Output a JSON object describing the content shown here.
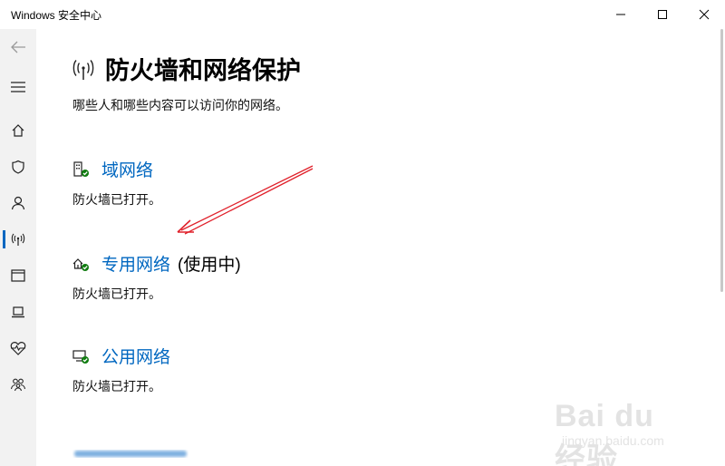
{
  "window": {
    "title": "Windows 安全中心"
  },
  "sidebar": {
    "items": [
      {
        "icon": "back-arrow-icon"
      },
      {
        "icon": "hamburger-menu-icon"
      },
      {
        "icon": "home-icon"
      },
      {
        "icon": "shield-icon"
      },
      {
        "icon": "person-icon"
      },
      {
        "icon": "wifi-antenna-icon",
        "active": true
      },
      {
        "icon": "app-browser-icon"
      },
      {
        "icon": "laptop-icon"
      },
      {
        "icon": "heart-pulse-icon"
      },
      {
        "icon": "family-icon"
      }
    ]
  },
  "main": {
    "title": "防火墙和网络保护",
    "subtitle": "哪些人和哪些内容可以访问你的网络。",
    "networks": [
      {
        "name": "域网络",
        "in_use": "",
        "status": "防火墙已打开。"
      },
      {
        "name": "专用网络",
        "in_use": "(使用中)",
        "status": "防火墙已打开。"
      },
      {
        "name": "公用网络",
        "in_use": "",
        "status": "防火墙已打开。"
      }
    ]
  },
  "watermark": {
    "brand": "Bai du 经验",
    "url": "jingyan.baidu.com"
  },
  "colors": {
    "link": "#0067c0",
    "sidebar_bg": "#f2f2f2",
    "annotation_arrow": "#e0202a",
    "check_badge": "#107c10"
  }
}
